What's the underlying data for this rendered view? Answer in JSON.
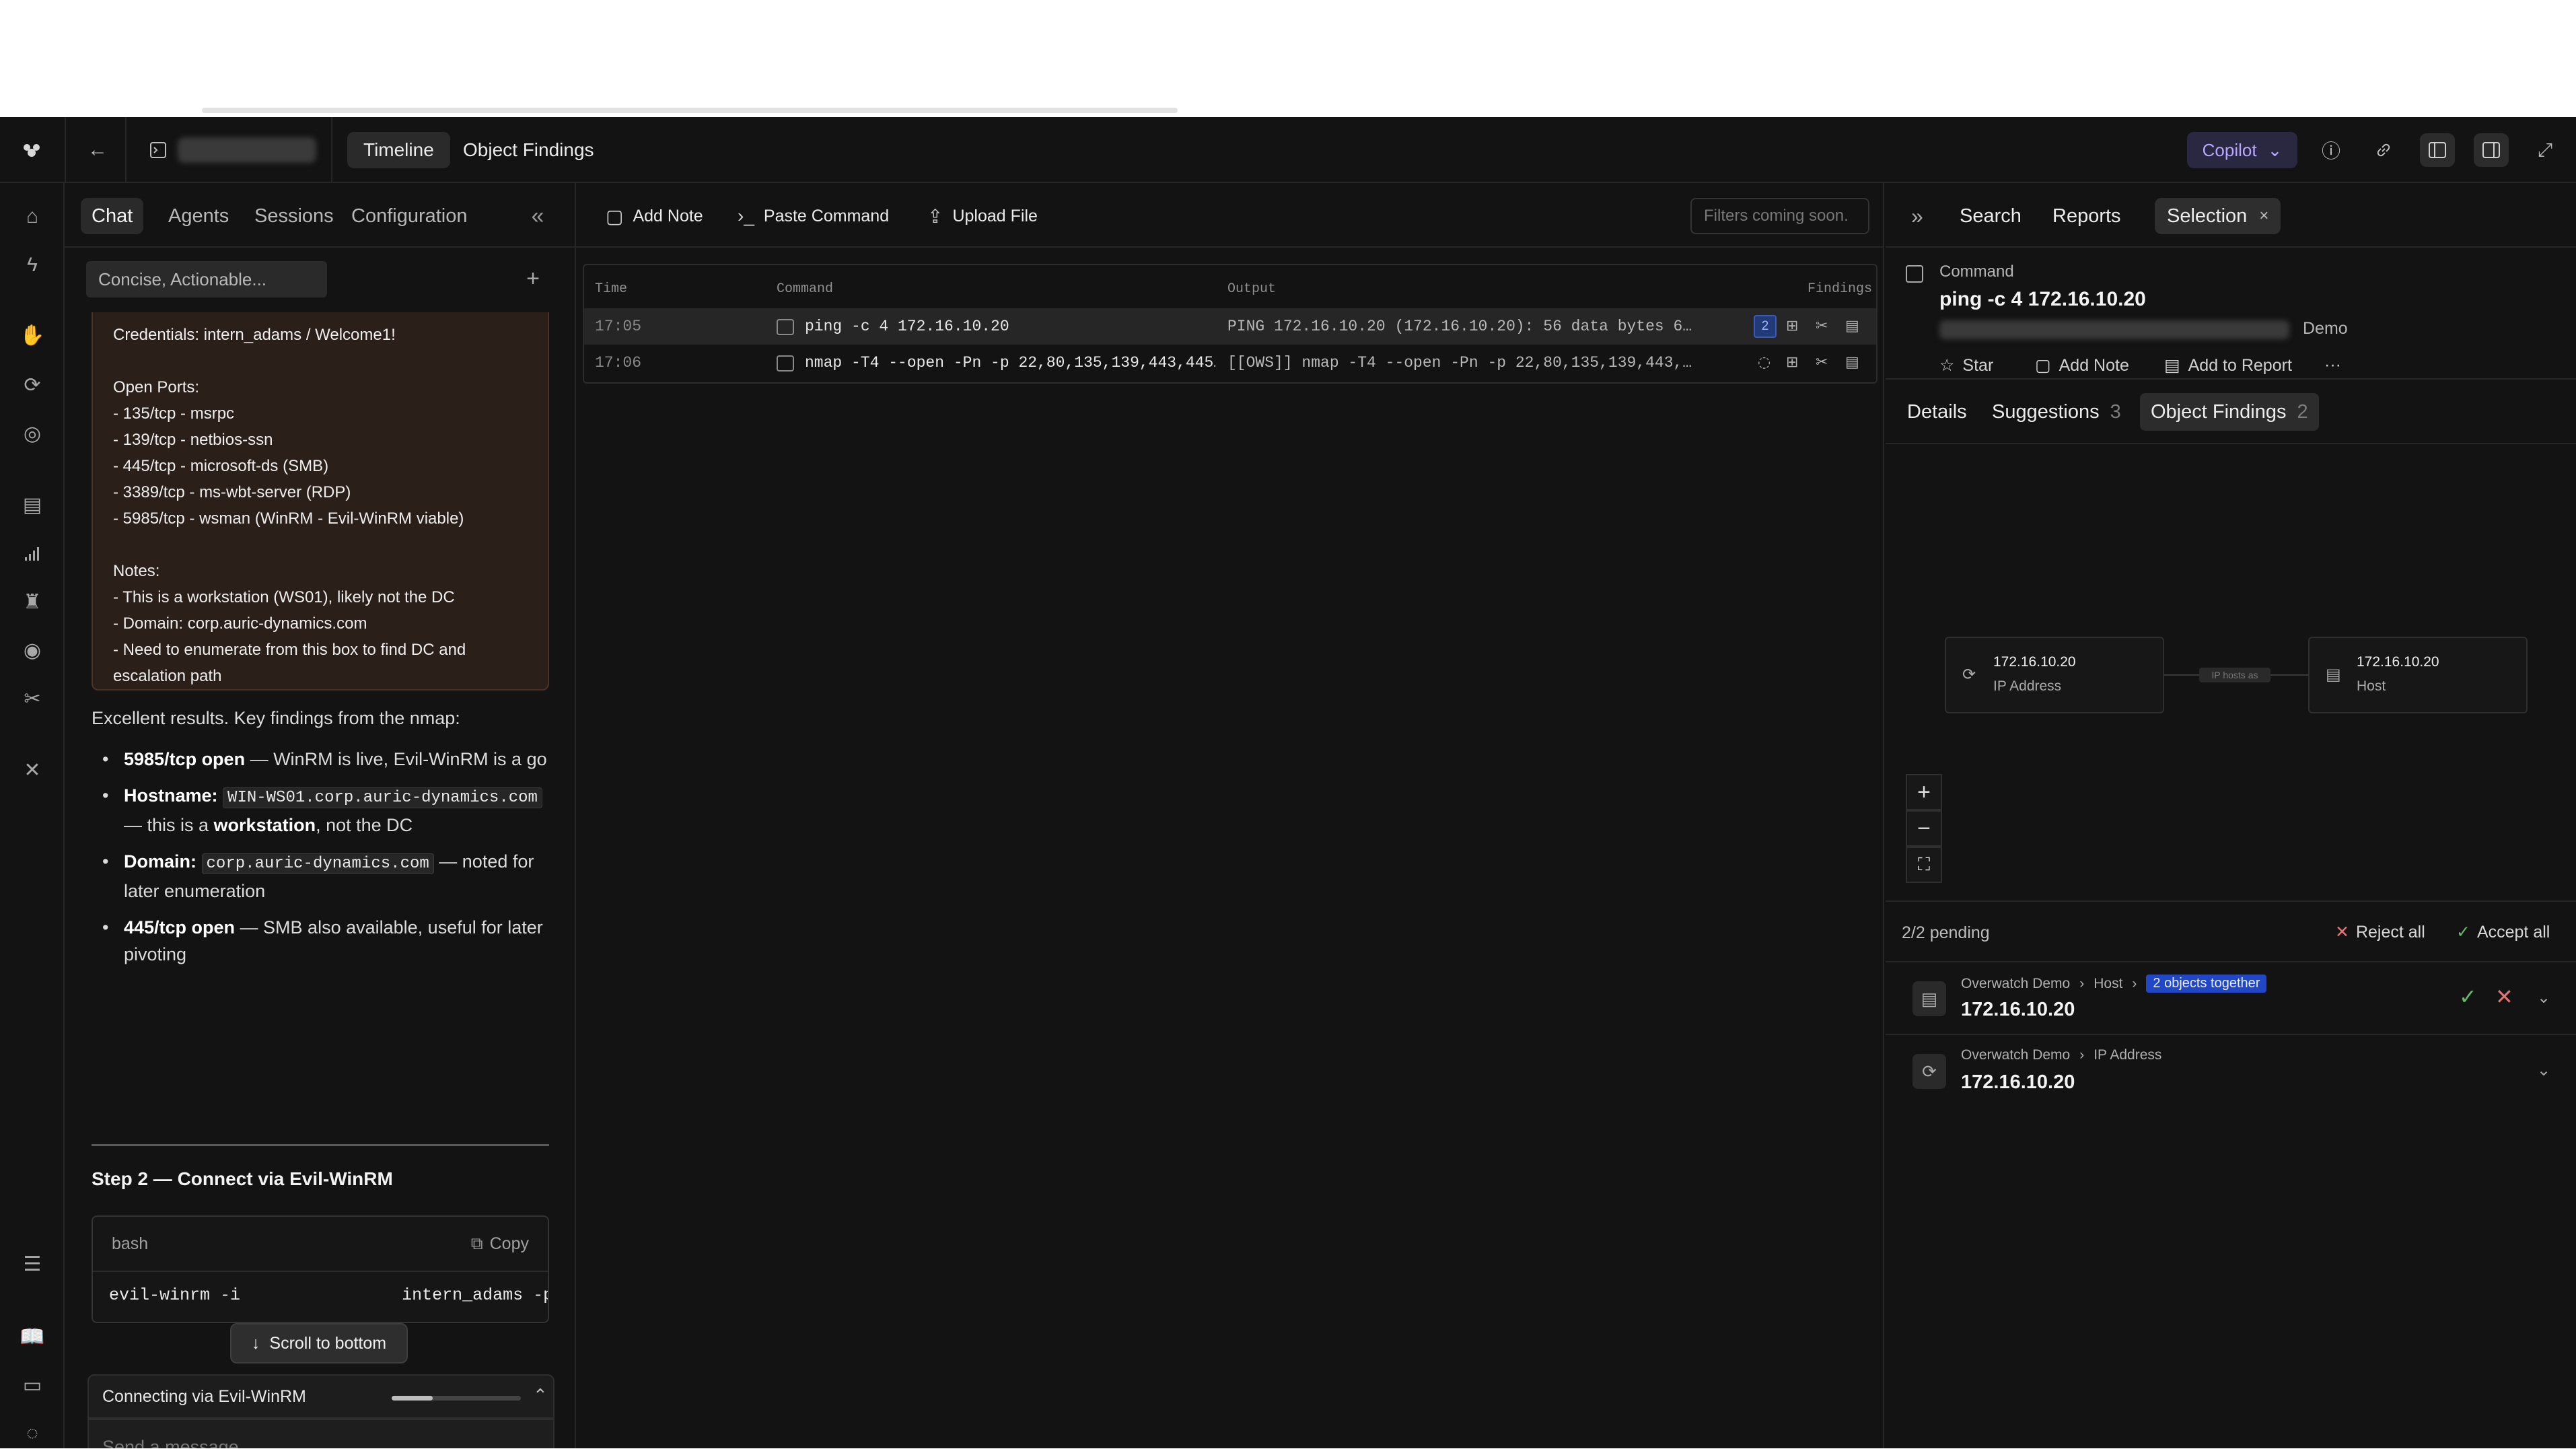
{
  "header": {
    "tabs": [
      {
        "label": "Timeline",
        "active": true
      },
      {
        "label": "Object Findings",
        "active": false
      }
    ],
    "copilot_label": "Copilot"
  },
  "chat": {
    "tabs": [
      "Chat",
      "Agents",
      "Sessions",
      "Configuration"
    ],
    "active_tab": "Chat",
    "mode_value": "Concise, Actionable...",
    "note_lines": [
      "Credentials: intern_adams / Welcome1!",
      "",
      "Open Ports:",
      "- 135/tcp - msrpc",
      "- 139/tcp - netbios-ssn",
      "- 445/tcp - microsoft-ds (SMB)",
      "- 3389/tcp - ms-wbt-server (RDP)",
      "- 5985/tcp - wsman (WinRM - Evil-WinRM viable)",
      "",
      "Notes:",
      "- This is a workstation (WS01), likely not the DC",
      "- Domain: corp.auric-dynamics.com",
      "- Need to enumerate from this box to find DC and escalation path"
    ],
    "intro": "Excellent results. Key findings from the nmap:",
    "bullets": [
      {
        "bold": "5985/tcp open",
        "code": "",
        "rest": " — WinRM is live, Evil-WinRM is a go"
      },
      {
        "bold": "Hostname:",
        "code": "WIN-WS01.corp.auric-dynamics.com",
        "rest": " — this is a ",
        "bold2": "workstation",
        "rest2": ", not the DC"
      },
      {
        "bold": "Domain:",
        "code": "corp.auric-dynamics.com",
        "rest": " — noted for later enumeration"
      },
      {
        "bold": "445/tcp open",
        "code": "",
        "rest": " — SMB also available, useful for later pivoting"
      }
    ],
    "step_heading": "Step 2 — Connect via Evil-WinRM",
    "code_lang": "bash",
    "copy_label": "Copy",
    "code_line_left": "evil-winrm -i",
    "code_line_right": "intern_adams -p",
    "scroll_label": "Scroll to bottom",
    "progress_label": "Connecting via Evil-WinRM",
    "progress_value": 0.32,
    "message_placeholder": "Send a message..."
  },
  "timeline": {
    "toolbar": {
      "add_note": "Add Note",
      "paste_command": "Paste Command",
      "upload_file": "Upload File",
      "filters_placeholder": "Filters coming soon."
    },
    "columns": [
      "Time",
      "Command",
      "Output",
      "Findings"
    ],
    "rows": [
      {
        "time": "17:05",
        "command": "ping -c 4 172.16.10.20",
        "output": "PING 172.16.10.20 (172.16.10.20): 56 data bytes 6…",
        "findings": "2"
      },
      {
        "time": "17:06",
        "command": "nmap -T4 --open -Pn -p 22,80,135,139,443,445…",
        "output": "[[OWS]] nmap -T4 --open -Pn -p 22,80,135,139,443,…",
        "findings": ""
      }
    ]
  },
  "right": {
    "tabs": [
      {
        "label": "Search"
      },
      {
        "label": "Reports"
      },
      {
        "label": "Selection"
      }
    ],
    "close_glyph": "×",
    "cmd_label": "Command",
    "cmd_title": "ping -c 4 172.16.10.20",
    "demo_label": "Demo",
    "actions": {
      "star": "Star",
      "add_note": "Add Note",
      "add_report": "Add to Report",
      "more": "···"
    },
    "subtabs": [
      {
        "label": "Details",
        "count": ""
      },
      {
        "label": "Suggestions",
        "count": "3"
      },
      {
        "label": "Object Findings",
        "count": "2"
      }
    ],
    "graph": {
      "left_node": {
        "title": "172.16.10.20",
        "sub": "IP Address"
      },
      "right_node": {
        "title": "172.16.10.20",
        "sub": "Host"
      },
      "edge_label": "IP  hosts as"
    },
    "pending_label": "2/2 pending",
    "reject_all": "Reject all",
    "accept_all": "Accept all",
    "findings": [
      {
        "project": "Overwatch Demo",
        "type": "Host",
        "badge": "2 objects together",
        "value": "172.16.10.20"
      },
      {
        "project": "Overwatch Demo",
        "type": "IP Address",
        "badge": "",
        "value": "172.16.10.20"
      }
    ]
  }
}
